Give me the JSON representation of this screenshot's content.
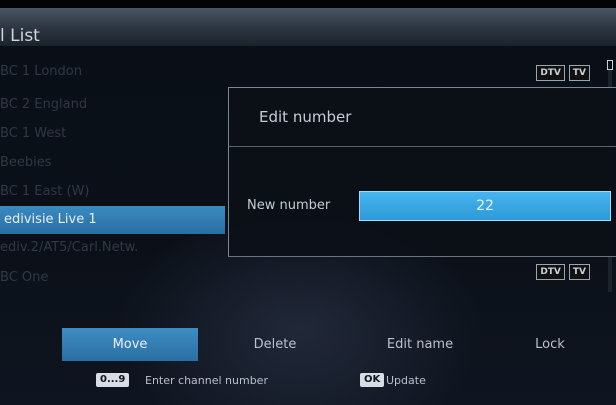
{
  "screen": {
    "title": "l List"
  },
  "channels": [
    {
      "name": "BC 1 London",
      "selected": false,
      "badges": [
        "DTV",
        "TV"
      ]
    },
    {
      "name": "BC 2 England",
      "selected": false,
      "badges": []
    },
    {
      "name": "BC 1 West",
      "selected": false,
      "badges": []
    },
    {
      "name": "Beebies",
      "selected": false,
      "badges": []
    },
    {
      "name": "BC 1 East (W)",
      "selected": false,
      "badges": []
    },
    {
      "name": "edivisie Live 1",
      "selected": true,
      "badges": []
    },
    {
      "name": "ediv.2/AT5/Carl.Netw.",
      "selected": false,
      "badges": []
    },
    {
      "name": "BC One",
      "selected": false,
      "badges": [
        "DTV",
        "TV"
      ]
    }
  ],
  "dialog": {
    "title": "Edit number",
    "label": "New number",
    "value": "22"
  },
  "actions": [
    {
      "label": "Move",
      "active": true
    },
    {
      "label": "Delete",
      "active": false
    },
    {
      "label": "Edit name",
      "active": false
    },
    {
      "label": "Lock",
      "active": false
    }
  ],
  "hints": {
    "numeric_key": "0...9",
    "numeric_text": "Enter channel number",
    "ok_key": "OK",
    "ok_text": "Update"
  },
  "colors": {
    "accent": "#2e9ad8",
    "selection": "#2a6fa3",
    "background": "#0b1018"
  }
}
